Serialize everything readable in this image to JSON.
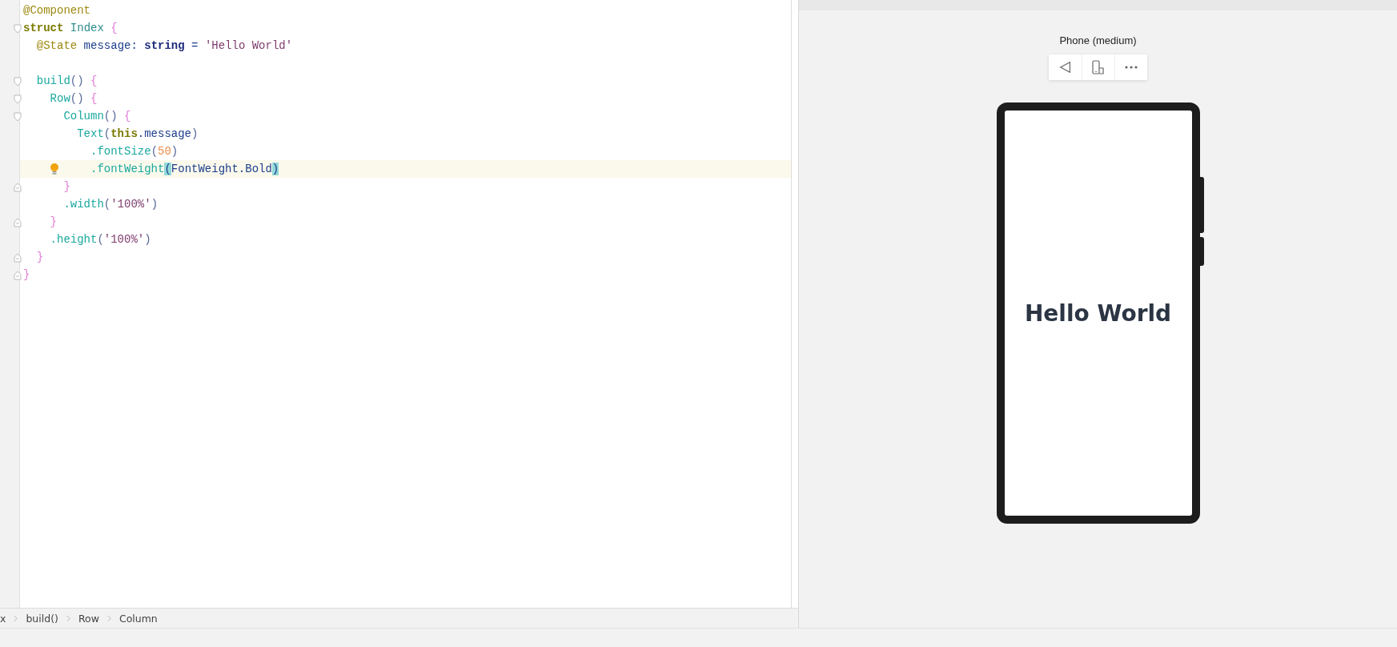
{
  "code": [
    {
      "tokens": [
        {
          "text": "@Component",
          "kind": "decorator"
        }
      ]
    },
    {
      "tokens": [
        {
          "text": "struct",
          "kind": "keyword"
        },
        {
          "text": " Index ",
          "kind": "type"
        },
        {
          "text": "{",
          "kind": "brace"
        }
      ],
      "closing": [
        {
          "text": "}",
          "kind": "brace"
        }
      ],
      "children": [
        {
          "gap_before": false,
          "tokens": [
            {
              "text": "@State",
              "kind": "decorator"
            },
            {
              "text": " message: ",
              "kind": "field"
            },
            {
              "text": "string",
              "kind": "builtin"
            },
            {
              "text": " = ",
              "kind": "field"
            },
            {
              "text": "'Hello World'",
              "kind": "string"
            }
          ]
        },
        {
          "gap_before": true,
          "tokens": [
            {
              "text": "build",
              "kind": "call"
            },
            {
              "text": "() ",
              "kind": "paren"
            },
            {
              "text": "{",
              "kind": "brace"
            }
          ],
          "closing": [
            {
              "text": "}",
              "kind": "brace"
            }
          ],
          "children": [
            {
              "tokens": [
                {
                  "text": "Row",
                  "kind": "call"
                },
                {
                  "text": "() ",
                  "kind": "paren"
                },
                {
                  "text": "{",
                  "kind": "brace"
                }
              ],
              "closing": [
                {
                  "text": "}",
                  "kind": "brace"
                }
              ],
              "children": [
                {
                  "tokens": [
                    {
                      "text": "Column",
                      "kind": "call"
                    },
                    {
                      "text": "() ",
                      "kind": "paren"
                    },
                    {
                      "text": "{",
                      "kind": "brace"
                    }
                  ],
                  "closing": [
                    {
                      "text": "}",
                      "kind": "brace"
                    }
                  ],
                  "children": [
                    {
                      "tokens": [
                        {
                          "text": "Text",
                          "kind": "call"
                        },
                        {
                          "text": "(",
                          "kind": "paren"
                        },
                        {
                          "text": "this",
                          "kind": "keyword"
                        },
                        {
                          "text": ".message",
                          "kind": "field"
                        },
                        {
                          "text": ")",
                          "kind": "paren"
                        }
                      ],
                      "children": [
                        {
                          "current": false,
                          "tokens": [
                            {
                              "text": ".fontSize",
                              "kind": "call"
                            },
                            {
                              "text": "(",
                              "kind": "paren"
                            },
                            {
                              "text": "50",
                              "kind": "number"
                            },
                            {
                              "text": ")",
                              "kind": "paren"
                            }
                          ]
                        },
                        {
                          "current": true,
                          "tokens": [
                            {
                              "text": ".fontWeight",
                              "kind": "call"
                            },
                            {
                              "text": "(",
                              "kind": "match"
                            },
                            {
                              "text": "FontWeight.Bold",
                              "kind": "field"
                            },
                            {
                              "text": ")",
                              "kind": "match"
                            }
                          ]
                        }
                      ]
                    }
                  ]
                },
                {
                  "tokens": [
                    {
                      "text": ".width",
                      "kind": "call"
                    },
                    {
                      "text": "(",
                      "kind": "paren"
                    },
                    {
                      "text": "'100%'",
                      "kind": "string"
                    },
                    {
                      "text": ")",
                      "kind": "paren"
                    }
                  ]
                }
              ]
            },
            {
              "tokens": [
                {
                  "text": ".height",
                  "kind": "call"
                },
                {
                  "text": "(",
                  "kind": "paren"
                },
                {
                  "text": "'100%'",
                  "kind": "string"
                },
                {
                  "text": ")",
                  "kind": "paren"
                }
              ]
            }
          ]
        }
      ]
    }
  ],
  "breadcrumbs": [
    "x",
    "build()",
    "Row",
    "Column"
  ],
  "previewer": {
    "device_name": "Phone (medium)",
    "screen_text": "Hello World"
  }
}
